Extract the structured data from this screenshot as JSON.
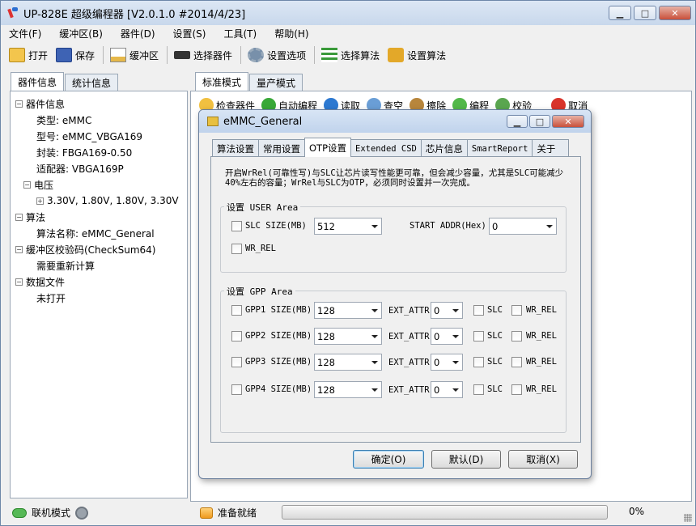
{
  "window": {
    "title": "UP-828E 超级编程器  [V2.0.1.0 #2014/4/23]"
  },
  "menu": [
    "文件(F)",
    "缓冲区(B)",
    "器件(D)",
    "设置(S)",
    "工具(T)",
    "帮助(H)"
  ],
  "toolbar": {
    "open": "打开",
    "save": "保存",
    "buffer": "缓冲区",
    "select_device": "选择器件",
    "settings": "设置选项",
    "select_algo": "选择算法",
    "set_algo": "设置算法"
  },
  "left_tabs": [
    "器件信息",
    "统计信息"
  ],
  "tree": {
    "device_info": "器件信息",
    "type": "类型: eMMC",
    "model": "型号: eMMC_VBGA169",
    "package": "封装: FBGA169-0.50",
    "adapter": "适配器: VBGA169P",
    "voltage": "电压",
    "voltage_values": "3.30V, 1.80V, 1.80V, 3.30V",
    "algo": "算法",
    "algo_name": "算法名称: eMMC_General",
    "checksum": "缓冲区校验码(CheckSum64)",
    "checksum_value": "需要重新计算",
    "data_file": "数据文件",
    "data_file_value": "未打开"
  },
  "right_tabs": [
    "标准模式",
    "量产模式"
  ],
  "right_toolbar": {
    "check": "检查器件",
    "auto": "自动编程",
    "read": "读取",
    "verify": "查空",
    "erase": "擦除",
    "program": "编程",
    "check2": "校验",
    "cancel": "取消"
  },
  "status": {
    "mode": "联机模式",
    "ready": "准备就绪",
    "percent": "0%",
    "progress": 0
  },
  "dialog": {
    "title": "eMMC_General",
    "tabs": [
      "算法设置",
      "常用设置",
      "OTP设置",
      "Extended CSD",
      "芯片信息",
      "SmartReport",
      "关于"
    ],
    "note": "开启WrRel(可靠性写)与SLC让芯片读写性能更可靠，但会减少容量，尤其是SLC可能减少40%左右的容量；WrRel与SLC为OTP，必须同时设置并一次完成。",
    "user_area": {
      "label": "设置 USER Area",
      "slc_size_label": "SLC SIZE(MB)",
      "slc_size_value": "512",
      "start_addr_label": "START ADDR(Hex)",
      "start_addr_value": "0",
      "wr_rel_label": "WR_REL"
    },
    "gpp_area": {
      "label": "设置 GPP Area",
      "rows": [
        {
          "label": "GPP1 SIZE(MB)",
          "size": "128",
          "ext_label": "EXT_ATTR",
          "ext": "0",
          "slc": "SLC",
          "wr_rel": "WR_REL"
        },
        {
          "label": "GPP2 SIZE(MB)",
          "size": "128",
          "ext_label": "EXT_ATTR",
          "ext": "0",
          "slc": "SLC",
          "wr_rel": "WR_REL"
        },
        {
          "label": "GPP3 SIZE(MB)",
          "size": "128",
          "ext_label": "EXT_ATTR",
          "ext": "0",
          "slc": "SLC",
          "wr_rel": "WR_REL"
        },
        {
          "label": "GPP4 SIZE(MB)",
          "size": "128",
          "ext_label": "EXT_ATTR",
          "ext": "0",
          "slc": "SLC",
          "wr_rel": "WR_REL"
        }
      ]
    },
    "buttons": {
      "ok": "确定(O)",
      "default": "默认(D)",
      "cancel": "取消(X)"
    }
  }
}
